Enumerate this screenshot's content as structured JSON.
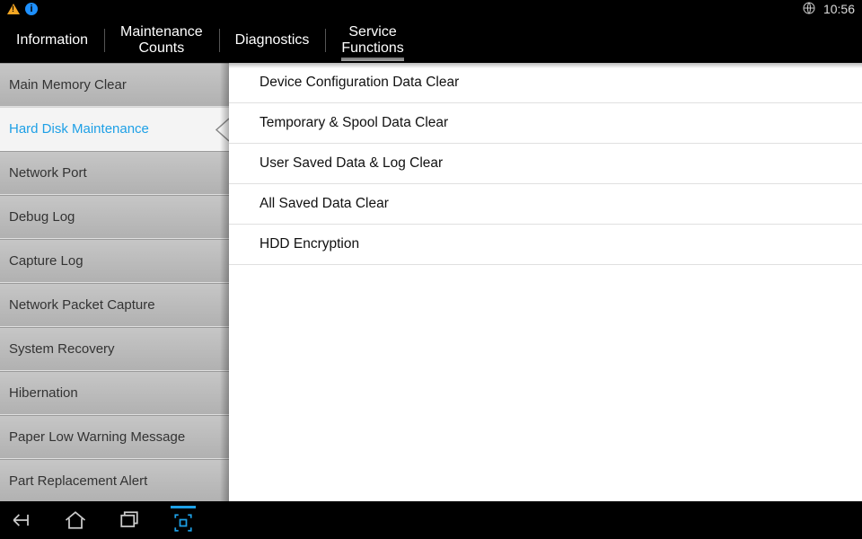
{
  "status_bar": {
    "clock": "10:56"
  },
  "tabs": [
    {
      "label_line1": "Information",
      "label_line2": ""
    },
    {
      "label_line1": "Maintenance",
      "label_line2": "Counts"
    },
    {
      "label_line1": "Diagnostics",
      "label_line2": ""
    },
    {
      "label_line1": "Service",
      "label_line2": "Functions"
    }
  ],
  "tabs_selected_index": 3,
  "sidebar": {
    "selected_index": 1,
    "items": [
      {
        "label": "Main Memory Clear"
      },
      {
        "label": "Hard Disk Maintenance"
      },
      {
        "label": "Network Port"
      },
      {
        "label": "Debug Log"
      },
      {
        "label": "Capture Log"
      },
      {
        "label": "Network Packet Capture"
      },
      {
        "label": "System Recovery"
      },
      {
        "label": "Hibernation"
      },
      {
        "label": "Paper Low Warning Message"
      },
      {
        "label": "Part Replacement Alert"
      }
    ]
  },
  "detail": {
    "items": [
      {
        "label": "Device Configuration Data Clear"
      },
      {
        "label": "Temporary & Spool Data Clear"
      },
      {
        "label": "User Saved Data & Log Clear"
      },
      {
        "label": "All Saved Data Clear"
      },
      {
        "label": "HDD Encryption"
      }
    ]
  }
}
